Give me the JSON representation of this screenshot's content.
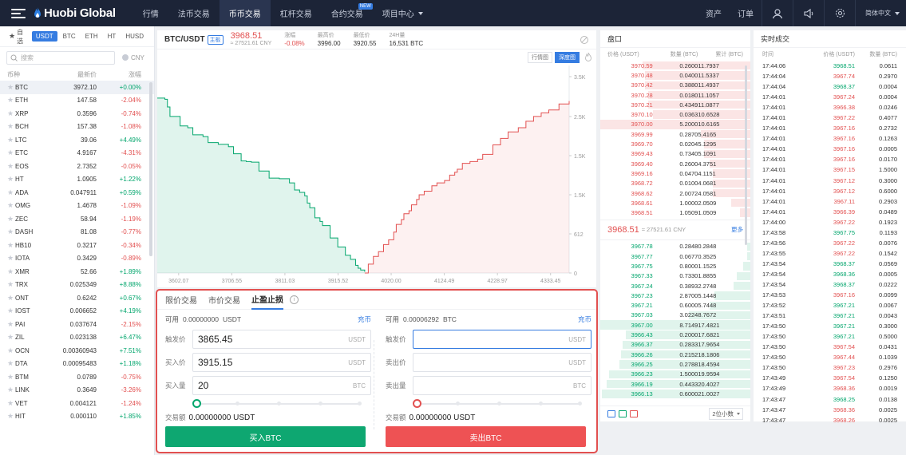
{
  "topbar": {
    "logo": "Huobi Global",
    "nav": [
      {
        "label": "行情"
      },
      {
        "label": "法币交易"
      },
      {
        "label": "币币交易",
        "active": true
      },
      {
        "label": "杠杆交易"
      },
      {
        "label": "合约交易",
        "badge": "NEW"
      },
      {
        "label": "项目中心",
        "dropdown": true
      }
    ],
    "right": {
      "assets": "资产",
      "orders": "订单",
      "language": "简体中文"
    }
  },
  "market": {
    "tabs": [
      "自选",
      "USDT",
      "BTC",
      "ETH",
      "HT",
      "HUSD"
    ],
    "active_tab": "USDT",
    "search_placeholder": "搜索",
    "currency": "CNY",
    "headers": {
      "coin": "币种",
      "price": "最新价",
      "change": "涨幅"
    },
    "rows": [
      {
        "coin": "BTC",
        "price": "3972.10",
        "change": "+0.00%",
        "dir": "up",
        "selected": true
      },
      {
        "coin": "ETH",
        "price": "147.58",
        "change": "-2.04%",
        "dir": "down"
      },
      {
        "coin": "XRP",
        "price": "0.3596",
        "change": "-0.74%",
        "dir": "down"
      },
      {
        "coin": "BCH",
        "price": "157.38",
        "change": "-1.08%",
        "dir": "down"
      },
      {
        "coin": "LTC",
        "price": "39.06",
        "change": "+4.49%",
        "dir": "up"
      },
      {
        "coin": "ETC",
        "price": "4.9167",
        "change": "-4.31%",
        "dir": "down"
      },
      {
        "coin": "EOS",
        "price": "2.7352",
        "change": "-0.05%",
        "dir": "down"
      },
      {
        "coin": "HT",
        "price": "1.0905",
        "change": "+1.22%",
        "dir": "up"
      },
      {
        "coin": "ADA",
        "price": "0.047911",
        "change": "+0.59%",
        "dir": "up"
      },
      {
        "coin": "OMG",
        "price": "1.4678",
        "change": "-1.09%",
        "dir": "down"
      },
      {
        "coin": "ZEC",
        "price": "58.94",
        "change": "-1.19%",
        "dir": "down"
      },
      {
        "coin": "DASH",
        "price": "81.08",
        "change": "-0.77%",
        "dir": "down"
      },
      {
        "coin": "HB10",
        "price": "0.3217",
        "change": "-0.34%",
        "dir": "down"
      },
      {
        "coin": "IOTA",
        "price": "0.3429",
        "change": "-0.89%",
        "dir": "down"
      },
      {
        "coin": "XMR",
        "price": "52.66",
        "change": "+1.89%",
        "dir": "up"
      },
      {
        "coin": "TRX",
        "price": "0.025349",
        "change": "+8.88%",
        "dir": "up"
      },
      {
        "coin": "ONT",
        "price": "0.6242",
        "change": "+0.67%",
        "dir": "up"
      },
      {
        "coin": "IOST",
        "price": "0.006652",
        "change": "+4.19%",
        "dir": "up"
      },
      {
        "coin": "PAI",
        "price": "0.037674",
        "change": "-2.15%",
        "dir": "down"
      },
      {
        "coin": "ZIL",
        "price": "0.023138",
        "change": "+6.47%",
        "dir": "up"
      },
      {
        "coin": "OCN",
        "price": "0.00360943",
        "change": "+7.51%",
        "dir": "up"
      },
      {
        "coin": "DTA",
        "price": "0.00095483",
        "change": "+1.18%",
        "dir": "up"
      },
      {
        "coin": "BTM",
        "price": "0.0789",
        "change": "-0.75%",
        "dir": "down"
      },
      {
        "coin": "LINK",
        "price": "0.3649",
        "change": "-3.26%",
        "dir": "down"
      },
      {
        "coin": "VET",
        "price": "0.004121",
        "change": "-1.24%",
        "dir": "down"
      },
      {
        "coin": "HIT",
        "price": "0.000110",
        "change": "+1.85%",
        "dir": "up"
      }
    ]
  },
  "ticker": {
    "pair": "BTC/USDT",
    "board": "主板",
    "price": "3968.51",
    "cny": "≈ 27521.61 CNY",
    "stats": [
      {
        "label": "涨幅",
        "value": "-0.08%",
        "dir": "down"
      },
      {
        "label": "最高价",
        "value": "3996.00"
      },
      {
        "label": "最低价",
        "value": "3920.55"
      },
      {
        "label": "24H量",
        "value": "16,531 BTC"
      }
    ],
    "chart_toggle": [
      "行情图",
      "深度图"
    ],
    "active_chart": "深度图"
  },
  "chart_data": {
    "type": "area",
    "x_ticks": [
      "3602.07",
      "3706.55",
      "3811.03",
      "3915.52",
      "4020.00",
      "4124.49",
      "4228.97",
      "4333.45"
    ],
    "y_ticks": [
      "3.5K",
      "2.5K",
      "1.5K",
      "1.5K",
      "612",
      "0"
    ],
    "xlim": [
      3560,
      4370
    ],
    "ylim": [
      0,
      3500
    ],
    "series": [
      {
        "side": "bid",
        "color": "#03a66d",
        "x": [
          3560,
          3570,
          3575,
          3580,
          3585,
          3600,
          3605,
          3620,
          3630,
          3650,
          3660,
          3680,
          3700,
          3710,
          3725,
          3735,
          3745,
          3760,
          3780,
          3800,
          3820,
          3830,
          3840,
          3850,
          3855,
          3860,
          3870,
          3880,
          3885,
          3900,
          3915,
          3930,
          3940,
          3950,
          3955,
          3960,
          3968
        ],
        "y": [
          2950,
          2950,
          2930,
          2800,
          2640,
          2640,
          2480,
          2450,
          2330,
          2300,
          2200,
          2170,
          2130,
          2010,
          1890,
          1880,
          1870,
          1720,
          1600,
          1590,
          1520,
          1400,
          1360,
          1300,
          1180,
          1100,
          930,
          870,
          800,
          590,
          440,
          300,
          230,
          130,
          80,
          50,
          20
        ]
      },
      {
        "side": "ask",
        "color": "#e25050",
        "x": [
          3968,
          3975,
          3985,
          3995,
          4005,
          4015,
          4025,
          4030,
          4040,
          4045,
          4055,
          4060,
          4070,
          4075,
          4085,
          4100,
          4110,
          4125,
          4135,
          4145,
          4150,
          4160,
          4175,
          4190,
          4200,
          4220,
          4235,
          4250,
          4270,
          4285,
          4300,
          4315,
          4330,
          4350,
          4370
        ],
        "y": [
          0,
          150,
          280,
          360,
          480,
          560,
          690,
          820,
          900,
          1000,
          1050,
          1150,
          1240,
          1320,
          1380,
          1470,
          1520,
          1560,
          1650,
          1700,
          1750,
          1850,
          1880,
          1920,
          2000,
          2160,
          2270,
          2380,
          2450,
          2560,
          2640,
          2700,
          2750,
          2850,
          2900
        ]
      }
    ]
  },
  "orderbook": {
    "title": "盘口",
    "headers": [
      "价格 (USDT)",
      "数量 (BTC)",
      "累计 (BTC)"
    ],
    "asks": [
      {
        "price": "3970.59",
        "amount": "0.2600",
        "total": "11.7937",
        "depth": 0.72
      },
      {
        "price": "3970.48",
        "amount": "0.0400",
        "total": "11.5337",
        "depth": 0.7
      },
      {
        "price": "3970.42",
        "amount": "0.3880",
        "total": "11.4937",
        "depth": 0.7
      },
      {
        "price": "3970.28",
        "amount": "0.0180",
        "total": "11.1057",
        "depth": 0.68
      },
      {
        "price": "3970.21",
        "amount": "0.4349",
        "total": "11.0877",
        "depth": 0.68
      },
      {
        "price": "3970.10",
        "amount": "0.0363",
        "total": "10.6528",
        "depth": 0.65
      },
      {
        "price": "3970.00",
        "amount": "5.2000",
        "total": "10.6165",
        "depth": 0.65,
        "hl": true
      },
      {
        "price": "3969.99",
        "amount": "0.2870",
        "total": "5.4165",
        "depth": 0.33
      },
      {
        "price": "3969.70",
        "amount": "0.0204",
        "total": "5.1295",
        "depth": 0.31
      },
      {
        "price": "3969.43",
        "amount": "0.7340",
        "total": "5.1091",
        "depth": 0.31
      },
      {
        "price": "3969.40",
        "amount": "0.2600",
        "total": "4.3751",
        "depth": 0.27
      },
      {
        "price": "3969.16",
        "amount": "0.0470",
        "total": "4.1151",
        "depth": 0.25
      },
      {
        "price": "3968.72",
        "amount": "0.0100",
        "total": "4.0681",
        "depth": 0.25
      },
      {
        "price": "3968.62",
        "amount": "2.0072",
        "total": "4.0581",
        "depth": 0.25
      },
      {
        "price": "3968.61",
        "amount": "1.0000",
        "total": "2.0509",
        "depth": 0.13
      },
      {
        "price": "3968.51",
        "amount": "1.0509",
        "total": "1.0509",
        "depth": 0.07
      }
    ],
    "mid_price": "3968.51",
    "mid_cny": "≈ 27521.61 CNY",
    "more": "更多",
    "bids": [
      {
        "price": "3967.78",
        "amount": "0.2848",
        "total": "0.2848",
        "depth": 0.02
      },
      {
        "price": "3967.77",
        "amount": "0.0677",
        "total": "0.3525",
        "depth": 0.02
      },
      {
        "price": "3967.75",
        "amount": "0.8000",
        "total": "1.1525",
        "depth": 0.05
      },
      {
        "price": "3967.33",
        "amount": "0.7330",
        "total": "1.8855",
        "depth": 0.09
      },
      {
        "price": "3967.24",
        "amount": "0.3893",
        "total": "2.2748",
        "depth": 0.11
      },
      {
        "price": "3967.23",
        "amount": "2.8700",
        "total": "5.1448",
        "depth": 0.24
      },
      {
        "price": "3967.21",
        "amount": "0.6000",
        "total": "5.7448",
        "depth": 0.27
      },
      {
        "price": "3967.03",
        "amount": "3.0224",
        "total": "8.7672",
        "depth": 0.41
      },
      {
        "price": "3967.00",
        "amount": "8.7149",
        "total": "17.4821",
        "depth": 0.82,
        "hl": true
      },
      {
        "price": "3966.43",
        "amount": "0.2000",
        "total": "17.6821",
        "depth": 0.83
      },
      {
        "price": "3966.37",
        "amount": "0.2833",
        "total": "17.9654",
        "depth": 0.85
      },
      {
        "price": "3966.26",
        "amount": "0.2152",
        "total": "18.1806",
        "depth": 0.86
      },
      {
        "price": "3966.25",
        "amount": "0.2788",
        "total": "18.4594",
        "depth": 0.87
      },
      {
        "price": "3966.23",
        "amount": "1.5000",
        "total": "19.9594",
        "depth": 0.94
      },
      {
        "price": "3966.19",
        "amount": "0.4433",
        "total": "20.4027",
        "depth": 0.96
      },
      {
        "price": "3966.13",
        "amount": "0.6000",
        "total": "21.0027",
        "depth": 0.99
      }
    ],
    "decimals": "2位小数"
  },
  "trades": {
    "title": "实时成交",
    "headers": [
      "时间",
      "价格 (USDT)",
      "数量 (BTC)"
    ],
    "rows": [
      {
        "time": "17:44:06",
        "price": "3968.51",
        "amount": "0.0611",
        "dir": "up"
      },
      {
        "time": "17:44:04",
        "price": "3967.74",
        "amount": "0.2970",
        "dir": "down"
      },
      {
        "time": "17:44:04",
        "price": "3968.37",
        "amount": "0.0004",
        "dir": "up"
      },
      {
        "time": "17:44:01",
        "price": "3967.24",
        "amount": "0.0004",
        "dir": "down"
      },
      {
        "time": "17:44:01",
        "price": "3966.38",
        "amount": "0.0246",
        "dir": "down"
      },
      {
        "time": "17:44:01",
        "price": "3967.22",
        "amount": "0.4077",
        "dir": "down"
      },
      {
        "time": "17:44:01",
        "price": "3967.16",
        "amount": "0.2732",
        "dir": "down"
      },
      {
        "time": "17:44:01",
        "price": "3967.16",
        "amount": "0.1263",
        "dir": "down"
      },
      {
        "time": "17:44:01",
        "price": "3967.16",
        "amount": "0.0005",
        "dir": "down"
      },
      {
        "time": "17:44:01",
        "price": "3967.16",
        "amount": "0.0170",
        "dir": "down"
      },
      {
        "time": "17:44:01",
        "price": "3967.15",
        "amount": "1.5000",
        "dir": "down"
      },
      {
        "time": "17:44:01",
        "price": "3967.12",
        "amount": "0.3000",
        "dir": "down"
      },
      {
        "time": "17:44:01",
        "price": "3967.12",
        "amount": "0.6000",
        "dir": "down"
      },
      {
        "time": "17:44:01",
        "price": "3967.11",
        "amount": "0.2903",
        "dir": "down"
      },
      {
        "time": "17:44:01",
        "price": "3966.39",
        "amount": "0.0489",
        "dir": "down"
      },
      {
        "time": "17:44:00",
        "price": "3967.22",
        "amount": "0.1923",
        "dir": "down"
      },
      {
        "time": "17:43:58",
        "price": "3967.75",
        "amount": "0.1193",
        "dir": "up"
      },
      {
        "time": "17:43:56",
        "price": "3967.22",
        "amount": "0.0076",
        "dir": "down"
      },
      {
        "time": "17:43:55",
        "price": "3967.22",
        "amount": "0.1542",
        "dir": "down"
      },
      {
        "time": "17:43:54",
        "price": "3968.37",
        "amount": "0.0569",
        "dir": "up"
      },
      {
        "time": "17:43:54",
        "price": "3968.36",
        "amount": "0.0005",
        "dir": "up"
      },
      {
        "time": "17:43:54",
        "price": "3968.37",
        "amount": "0.0222",
        "dir": "up"
      },
      {
        "time": "17:43:53",
        "price": "3967.16",
        "amount": "0.0099",
        "dir": "down"
      },
      {
        "time": "17:43:52",
        "price": "3967.21",
        "amount": "0.0067",
        "dir": "up"
      },
      {
        "time": "17:43:51",
        "price": "3967.21",
        "amount": "0.0043",
        "dir": "up"
      },
      {
        "time": "17:43:50",
        "price": "3967.21",
        "amount": "0.3000",
        "dir": "up"
      },
      {
        "time": "17:43:50",
        "price": "3967.21",
        "amount": "0.5000",
        "dir": "up"
      },
      {
        "time": "17:43:50",
        "price": "3967.54",
        "amount": "0.0431",
        "dir": "down"
      },
      {
        "time": "17:43:50",
        "price": "3967.44",
        "amount": "0.1039",
        "dir": "down"
      },
      {
        "time": "17:43:50",
        "price": "3967.23",
        "amount": "0.2976",
        "dir": "down"
      },
      {
        "time": "17:43:49",
        "price": "3967.54",
        "amount": "0.1250",
        "dir": "down"
      },
      {
        "time": "17:43:49",
        "price": "3968.36",
        "amount": "0.0019",
        "dir": "down"
      },
      {
        "time": "17:43:47",
        "price": "3968.25",
        "amount": "0.0138",
        "dir": "up"
      },
      {
        "time": "17:43:47",
        "price": "3968.36",
        "amount": "0.0025",
        "dir": "down"
      },
      {
        "time": "17:43:47",
        "price": "3968.26",
        "amount": "0.0025",
        "dir": "down"
      }
    ]
  },
  "form": {
    "tabs": [
      "限价交易",
      "市价交易",
      "止盈止损"
    ],
    "active_tab": "止盈止损",
    "info": "i",
    "buy": {
      "available_label": "可用",
      "available": "0.00000000",
      "available_unit": "USDT",
      "deposit": "充币",
      "trigger_label": "触发价",
      "trigger": "3865.45",
      "trigger_unit": "USDT",
      "price_label": "买入价",
      "price": "3915.15",
      "price_unit": "USDT",
      "amount_label": "买入量",
      "amount": "20",
      "amount_unit": "BTC",
      "slider": 0,
      "total_label": "交易额",
      "total": "0.00000000 USDT",
      "button": "买入BTC"
    },
    "sell": {
      "available_label": "可用",
      "available": "0.00006292",
      "available_unit": "BTC",
      "deposit": "充币",
      "trigger_label": "触发价",
      "trigger": "",
      "trigger_unit": "USDT",
      "price_label": "卖出价",
      "price": "",
      "price_unit": "USDT",
      "amount_label": "卖出量",
      "amount": "",
      "amount_unit": "BTC",
      "slider": 0,
      "total_label": "交易额",
      "total": "0.00000000 USDT",
      "button": "卖出BTC"
    }
  }
}
